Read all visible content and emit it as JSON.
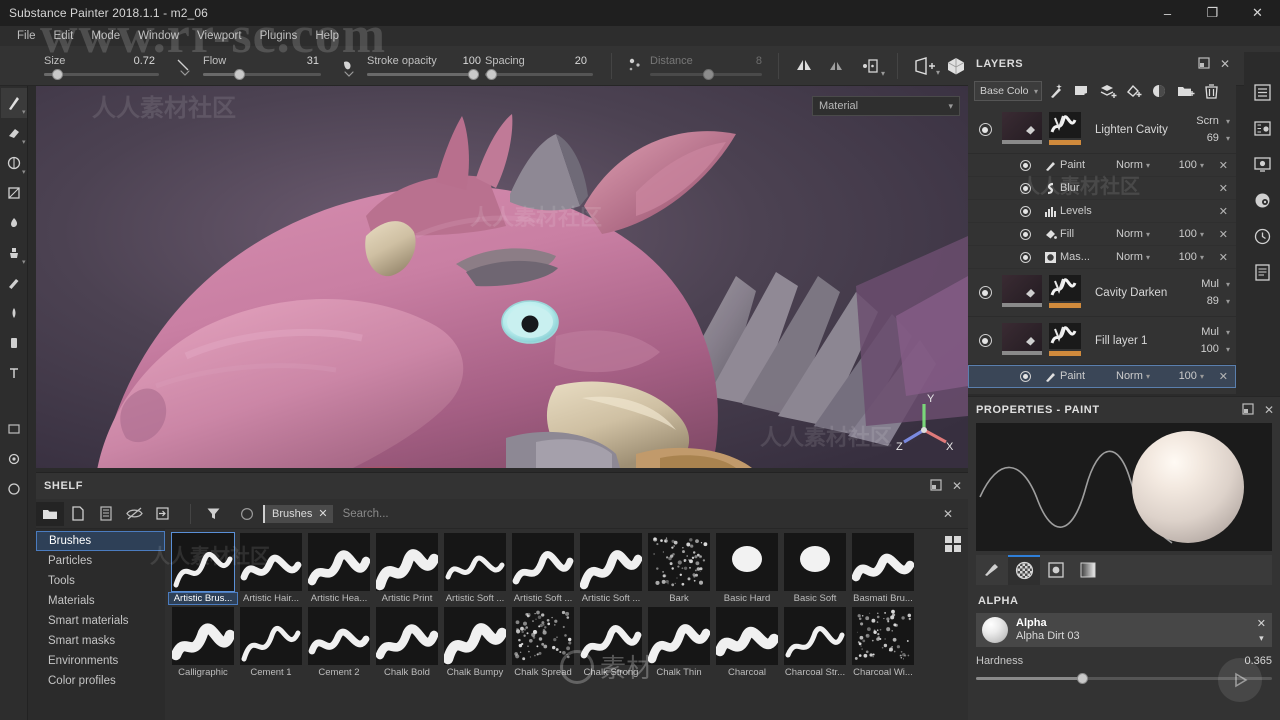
{
  "window": {
    "title": "Substance Painter 2018.1.1 - m2_06",
    "minimize": "–",
    "maximize": "❐",
    "close": "✕"
  },
  "menubar": {
    "items": [
      "File",
      "Edit",
      "Mode",
      "Window",
      "Viewport",
      "Plugins",
      "Help"
    ]
  },
  "toolstrip": {
    "params": [
      {
        "label": "Size",
        "value": "0.72"
      },
      {
        "label": "Flow",
        "value": "31"
      },
      {
        "label": "Stroke opacity",
        "value": "100"
      },
      {
        "label": "Spacing",
        "value": "20"
      },
      {
        "label": "Distance",
        "value": "8"
      }
    ],
    "buttons": [
      "symmetry-icon",
      "symmetry-plane-icon",
      "projection-icon",
      "camera-perspective-icon",
      "shading-mode-icon",
      "camera-view-icon",
      "screenshot-icon"
    ]
  },
  "leftrail": {
    "items": [
      "paint-tool-icon",
      "eraser-tool-icon",
      "projection-tool-icon",
      "polygon-fill-icon",
      "smudge-tool-icon",
      "clone-tool-icon",
      "material-picker-icon",
      "particle-tool-icon",
      "physical-paint-icon",
      "text-tool-icon",
      "select-tool-icon",
      "settings-icon",
      "preferences-icon"
    ]
  },
  "viewport": {
    "material_dropdown": "Material",
    "axis_labels": {
      "x": "X",
      "y": "Y",
      "z": "Z"
    }
  },
  "shelf": {
    "title": "SHELF",
    "toolbar_left": [
      "new-folder-icon",
      "new-file-icon",
      "list-icon",
      "hide-icon",
      "import-icon"
    ],
    "filter_icon": "filter-icon",
    "circle_icon": "circle-icon",
    "tag": "Brushes",
    "tag_close": "✕",
    "search_placeholder": "Search...",
    "search_value": "",
    "clear_search": "✕",
    "panel_restore": "❐",
    "panel_close": "✕",
    "grid_view_icon": "grid-view-icon",
    "categories": [
      "Brushes",
      "Particles",
      "Tools",
      "Materials",
      "Smart materials",
      "Smart masks",
      "Environments",
      "Color profiles"
    ],
    "selected_category": "Brushes",
    "brushes": [
      {
        "name": "Artistic Brus...",
        "selected": true,
        "shape": "wave"
      },
      {
        "name": "Artistic Hair...",
        "selected": false,
        "shape": "wave"
      },
      {
        "name": "Artistic Hea...",
        "selected": false,
        "shape": "wave"
      },
      {
        "name": "Artistic Print",
        "selected": false,
        "shape": "wave"
      },
      {
        "name": "Artistic Soft ...",
        "selected": false,
        "shape": "wave"
      },
      {
        "name": "Artistic Soft ...",
        "selected": false,
        "shape": "wave"
      },
      {
        "name": "Artistic Soft ...",
        "selected": false,
        "shape": "wave"
      },
      {
        "name": "Bark",
        "selected": false,
        "shape": "speck"
      },
      {
        "name": "Basic Hard",
        "selected": false,
        "shape": "blob"
      },
      {
        "name": "Basic Soft",
        "selected": false,
        "shape": "blob"
      },
      {
        "name": "Basmati Bru...",
        "selected": false,
        "shape": "wave"
      },
      {
        "name": "Calligraphic",
        "selected": false,
        "shape": "wave"
      },
      {
        "name": "Cement 1",
        "selected": false,
        "shape": "wave"
      },
      {
        "name": "Cement 2",
        "selected": false,
        "shape": "wave"
      },
      {
        "name": "Chalk Bold",
        "selected": false,
        "shape": "wave"
      },
      {
        "name": "Chalk Bumpy",
        "selected": false,
        "shape": "wave"
      },
      {
        "name": "Chalk Spread",
        "selected": false,
        "shape": "speck"
      },
      {
        "name": "Chalk Strong",
        "selected": false,
        "shape": "wave"
      },
      {
        "name": "Chalk Thin",
        "selected": false,
        "shape": "wave"
      },
      {
        "name": "Charcoal",
        "selected": false,
        "shape": "wave"
      },
      {
        "name": "Charcoal Str...",
        "selected": false,
        "shape": "wave"
      },
      {
        "name": "Charcoal Wi...",
        "selected": false,
        "shape": "speck"
      }
    ]
  },
  "layers": {
    "title": "LAYERS",
    "panel_restore": "❐",
    "panel_close": "✕",
    "channel_selector": "Base Colo",
    "toolbar_icons": [
      "magic-wand-icon",
      "add-paint-layer-icon",
      "add-group-icon",
      "add-fill-layer-icon",
      "add-adjustment-icon",
      "add-folder-icon",
      "delete-icon"
    ],
    "items": [
      {
        "name": "Lighten Cavity",
        "blend": "Scrn",
        "opacity": "69",
        "visible": true,
        "sublayers": [
          {
            "name": "Paint",
            "icon": "brush-icon",
            "blend": "Norm",
            "opacity": "100",
            "close": "✕",
            "selected": false
          },
          {
            "name": "Blur",
            "icon": "blur-icon",
            "blend": "",
            "opacity": "",
            "close": "✕",
            "selected": false
          },
          {
            "name": "Levels",
            "icon": "levels-icon",
            "blend": "",
            "opacity": "",
            "close": "✕",
            "selected": false
          },
          {
            "name": "Fill",
            "icon": "fill-icon",
            "blend": "Norm",
            "opacity": "100",
            "close": "✕",
            "selected": false
          },
          {
            "name": "Mas...",
            "icon": "mask-icon",
            "blend": "Norm",
            "opacity": "100",
            "close": "✕",
            "selected": false
          }
        ]
      },
      {
        "name": "Cavity Darken",
        "blend": "Mul",
        "opacity": "89",
        "visible": true,
        "sublayers": []
      },
      {
        "name": "Fill layer 1",
        "blend": "Mul",
        "opacity": "100",
        "visible": true,
        "sublayers": [
          {
            "name": "Paint",
            "icon": "brush-icon",
            "blend": "Norm",
            "opacity": "100",
            "close": "✕",
            "selected": true
          }
        ]
      }
    ]
  },
  "rightrail": {
    "items": [
      "layers-list-icon",
      "texture-set-settings-icon",
      "texture-set-list-icon",
      "shader-settings-icon",
      "history-icon",
      "display-settings-icon"
    ]
  },
  "properties": {
    "title": "PROPERTIES - PAINT",
    "panel_restore": "❐",
    "panel_close": "✕",
    "tabs": [
      {
        "icon": "brush-stroke-icon",
        "active": false
      },
      {
        "icon": "alpha-grid-icon",
        "active": true
      },
      {
        "icon": "stencil-icon",
        "active": false
      },
      {
        "icon": "gradient-icon",
        "active": false
      }
    ],
    "alpha_section_title": "ALPHA",
    "alpha_label": "Alpha",
    "alpha_value": "Alpha Dirt 03",
    "alpha_close": "✕",
    "alpha_chevron": "ˇ",
    "hardness_label": "Hardness",
    "hardness_value": "0.365"
  },
  "watermarks": {
    "main": "www.rr-sc.com",
    "cn_text": "人人素材社区",
    "bottom": "素材"
  },
  "colors": {
    "accent": "#2f7fd8",
    "select_blue": "#4b7cbf",
    "panel_bg": "#333333",
    "dark_bg": "#2b2b2b",
    "orange_mask": "#d08a3c"
  }
}
